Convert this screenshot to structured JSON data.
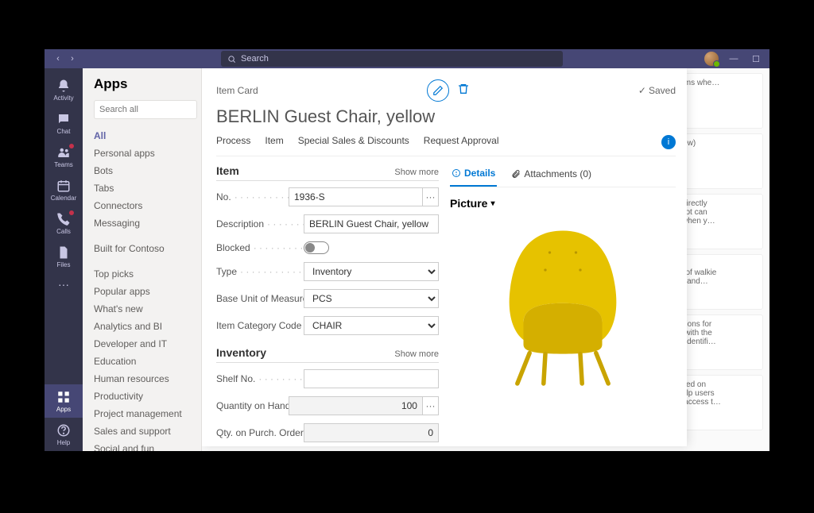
{
  "titlebar": {
    "search_placeholder": "Search"
  },
  "rail": {
    "activity": "Activity",
    "chat": "Chat",
    "teams": "Teams",
    "calendar": "Calendar",
    "calls": "Calls",
    "files": "Files",
    "apps": "Apps",
    "help": "Help"
  },
  "sidebar": {
    "title": "Apps",
    "search_placeholder": "Search all",
    "primary": [
      "All",
      "Personal apps",
      "Bots",
      "Tabs",
      "Connectors",
      "Messaging"
    ],
    "built": "Built for Contoso",
    "categories": [
      "Top picks",
      "Popular apps",
      "What's new",
      "Analytics and BI",
      "Developer and IT",
      "Education",
      "Human resources",
      "Productivity",
      "Project management",
      "Sales and support",
      "Social and fun"
    ]
  },
  "bg": {
    "c0": "platforms whe…",
    "c1": "(Preview)",
    "c2": "mers directly\nights bot can\nmers when y…",
    "c3": "ement,\nations of walkie\ntalkies and…",
    "c4": "nspections for\npitally with the\nssues identifi…",
    "c5": "on based on\nd to help users\nu can access t…"
  },
  "card": {
    "breadcrumb": "Item Card",
    "saved": "Saved",
    "title": "BERLIN Guest Chair, yellow",
    "actions": {
      "process": "Process",
      "item": "Item",
      "special": "Special Sales & Discounts",
      "approval": "Request Approval"
    },
    "sections": {
      "item": "Item",
      "inventory": "Inventory",
      "show_more": "Show more"
    },
    "item": {
      "no_label": "No.",
      "no_value": "1936-S",
      "desc_label": "Description",
      "desc_value": "BERLIN Guest Chair, yellow",
      "blocked_label": "Blocked",
      "type_label": "Type",
      "type_value": "Inventory",
      "uom_label": "Base Unit of Measure",
      "uom_value": "PCS",
      "cat_label": "Item Category Code",
      "cat_value": "CHAIR"
    },
    "inventory": {
      "shelf_label": "Shelf No.",
      "shelf_value": "",
      "qoh_label": "Quantity on Hand",
      "qoh_value": "100",
      "qpo_label": "Qty. on Purch. Order",
      "qpo_value": "0"
    },
    "tabs": {
      "details": "Details",
      "attachments": "Attachments (0)"
    },
    "picture": "Picture"
  }
}
